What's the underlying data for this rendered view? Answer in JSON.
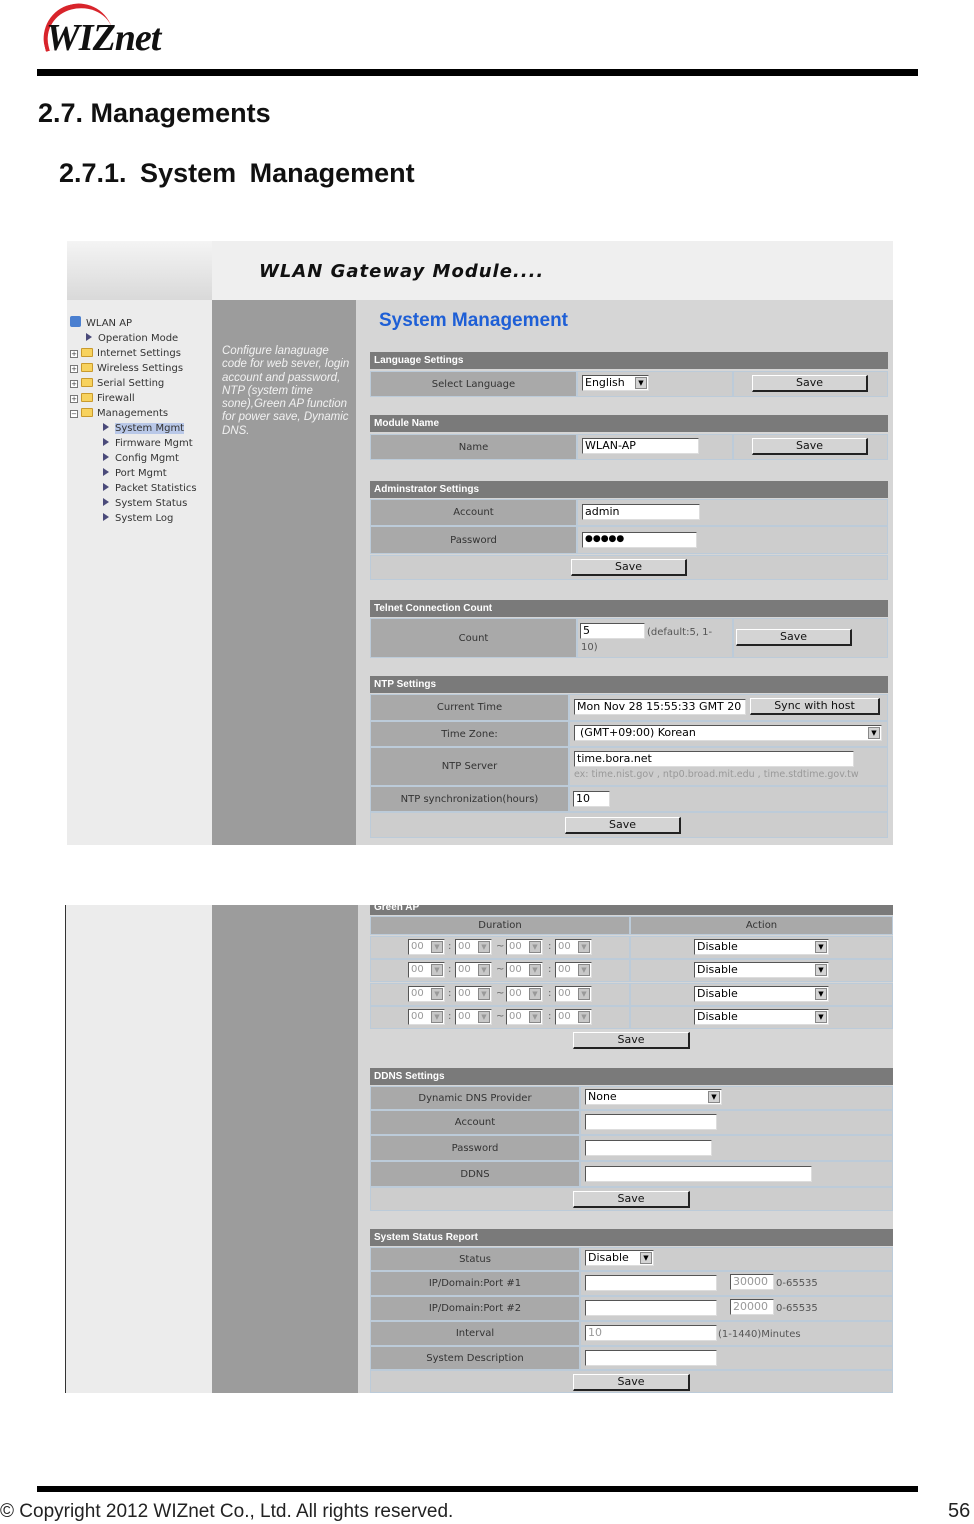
{
  "doc": {
    "logo_text": "WIZnet",
    "section": "2.7. Managements",
    "subsection": "2.7.1.  System  Management",
    "copyright": "© Copyright 2012 WIZnet Co., Ltd. All rights reserved.",
    "page_number": "56"
  },
  "app": {
    "title": "WLAN Gateway Module....",
    "page_title": "System Management",
    "description": "Configure lanaguage code for web sever, login account and password, NTP (system time sone),Green AP function for power save, Dynamic DNS.",
    "tree": {
      "root": "WLAN AP",
      "items": [
        "Operation Mode",
        "Internet Settings",
        "Wireless Settings",
        "Serial Setting",
        "Firewall",
        "Managements"
      ],
      "sub_items": [
        "System Mgmt",
        "Firmware Mgmt",
        "Config Mgmt",
        "Port Mgmt",
        "Packet Statistics",
        "System Status",
        "System Log"
      ],
      "selected": "System Mgmt"
    },
    "accent_color": "#1e5fd6"
  },
  "language": {
    "header": "Language Settings",
    "label": "Select Language",
    "value": "English",
    "save": "Save"
  },
  "module": {
    "header": "Module Name",
    "label": "Name",
    "value": "WLAN-AP",
    "save": "Save"
  },
  "admin": {
    "header": "Adminstrator Settings",
    "account_label": "Account",
    "account": "admin",
    "password_label": "Password",
    "password": "●●●●●",
    "save": "Save"
  },
  "telnet": {
    "header": "Telnet Connection Count",
    "label": "Count",
    "value": "5",
    "hint": "(default:5, 1-",
    "hint2": "10)",
    "save": "Save"
  },
  "ntp": {
    "header": "NTP Settings",
    "current_time_label": "Current Time",
    "current_time": "Mon Nov 28 15:55:33 GMT 20",
    "sync": "Sync with host",
    "tz_label": "Time Zone:",
    "tz": "(GMT+09:00) Korean",
    "server_label": "NTP Server",
    "server": "time.bora.net",
    "server_hint": "ex: time.nist.gov , ntp0.broad.mit.edu , time.stdtime.gov.tw",
    "sync_label": "NTP synchronization(hours)",
    "sync_hours": "10",
    "save": "Save"
  },
  "green_ap": {
    "header": "Green AP",
    "duration": "Duration",
    "action": "Action",
    "rows": [
      {
        "t": [
          "00",
          "00",
          "00",
          "00"
        ],
        "sep": "~",
        "action": "Disable"
      },
      {
        "t": [
          "00",
          "00",
          "00",
          "00"
        ],
        "sep": "~",
        "action": "Disable"
      },
      {
        "t": [
          "00",
          "00",
          "00",
          "00"
        ],
        "sep": "~",
        "action": "Disable"
      },
      {
        "t": [
          "00",
          "00",
          "00",
          "00"
        ],
        "sep": "~",
        "action": "Disable"
      }
    ],
    "colon": ":",
    "save": "Save"
  },
  "ddns": {
    "header": "DDNS Settings",
    "provider_label": "Dynamic DNS Provider",
    "provider": "None",
    "account_label": "Account",
    "password_label": "Password",
    "ddns_label": "DDNS",
    "save": "Save"
  },
  "ssr": {
    "header": "System Status Report",
    "status_label": "Status",
    "status": "Disable",
    "port1_label": "IP/Domain:Port #1",
    "port1": "30000",
    "port2_label": "IP/Domain:Port #2",
    "port2": "20000",
    "range": "0-65535",
    "interval_label": "Interval",
    "interval": "10",
    "interval_hint": "(1-1440)Minutes",
    "desc_label": "System Description",
    "save": "Save"
  }
}
